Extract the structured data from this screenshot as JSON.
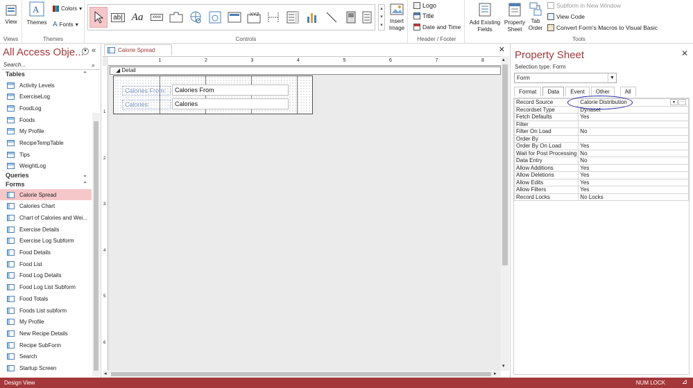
{
  "ribbon": {
    "views": {
      "view_label": "View",
      "group_label": "Views"
    },
    "themes": {
      "themes_label": "Themes",
      "colors_label": "Colors",
      "fonts_label": "Fonts",
      "group_label": "Themes"
    },
    "controls": {
      "group_label": "Controls",
      "insert_image_label": "Insert Image"
    },
    "header_footer": {
      "logo_label": "Logo",
      "title_label": "Title",
      "date_time_label": "Date and Time",
      "group_label": "Header / Footer"
    },
    "tools": {
      "add_existing_fields_label": "Add Existing Fields",
      "property_sheet_label": "Property Sheet",
      "tab_order_label": "Tab Order",
      "subform_new_window_label": "Subform in New Window",
      "view_code_label": "View Code",
      "convert_macros_label": "Convert Form's Macros to Visual Basic",
      "group_label": "Tools"
    }
  },
  "nav": {
    "title": "All Access Obje...",
    "search_placeholder": "Search...",
    "tables_header": "Tables",
    "tables": [
      "Activity Levels",
      "ExerciseLog",
      "FoodLog",
      "Foods",
      "My Profile",
      "RecipeTempTable",
      "Tips",
      "WeightLog"
    ],
    "queries_header": "Queries",
    "forms_header": "Forms",
    "forms": [
      "Calorie Spread",
      "Calories Chart",
      "Chart of Calories and Wei...",
      "Exercise Details",
      "Exercise Log Subform",
      "Food Details",
      "Food List",
      "Food Log Details",
      "Food Log List Subform",
      "Food Totals",
      "Foods List subform",
      "My Profile",
      "New Recipe Details",
      "Recipe SubForm",
      "Search",
      "Startup Screen"
    ],
    "selected_form": "Calorie Spread"
  },
  "document": {
    "tab_title": "Calorie Spread",
    "detail_label": "Detail",
    "ruler_numbers": [
      "1",
      "2",
      "3",
      "4",
      "5",
      "6",
      "7",
      "8"
    ],
    "vruler_numbers": [
      "1",
      "2",
      "3",
      "4",
      "5",
      "6"
    ],
    "fields": [
      {
        "label": "Calories From:",
        "value": "Calories From"
      },
      {
        "label": "Calories:",
        "value": "Calories"
      }
    ]
  },
  "property_sheet": {
    "title": "Property Sheet",
    "selection_type": "Selection type:  Form",
    "dropdown_value": "Form",
    "tabs": [
      "Format",
      "Data",
      "Event",
      "Other",
      "All"
    ],
    "active_tab": "Data",
    "properties": [
      {
        "name": "Record Source",
        "value": "Calorie Distribution"
      },
      {
        "name": "Recordset Type",
        "value": "Dynaset"
      },
      {
        "name": "Fetch Defaults",
        "value": "Yes"
      },
      {
        "name": "Filter",
        "value": ""
      },
      {
        "name": "Filter On Load",
        "value": "No"
      },
      {
        "name": "Order By",
        "value": ""
      },
      {
        "name": "Order By On Load",
        "value": "Yes"
      },
      {
        "name": "Wait for Post Processing",
        "value": "No"
      },
      {
        "name": "Data Entry",
        "value": "No"
      },
      {
        "name": "Allow Additions",
        "value": "Yes"
      },
      {
        "name": "Allow Deletions",
        "value": "Yes"
      },
      {
        "name": "Allow Edits",
        "value": "Yes"
      },
      {
        "name": "Allow Filters",
        "value": "Yes"
      },
      {
        "name": "Record Locks",
        "value": "No Locks"
      }
    ]
  },
  "status": {
    "left": "Design View",
    "right": "NUM LOCK"
  },
  "colors": {
    "accent": "#a4373a",
    "selected_bg": "#f6c7c9",
    "annotation": "#1a1aa6"
  }
}
